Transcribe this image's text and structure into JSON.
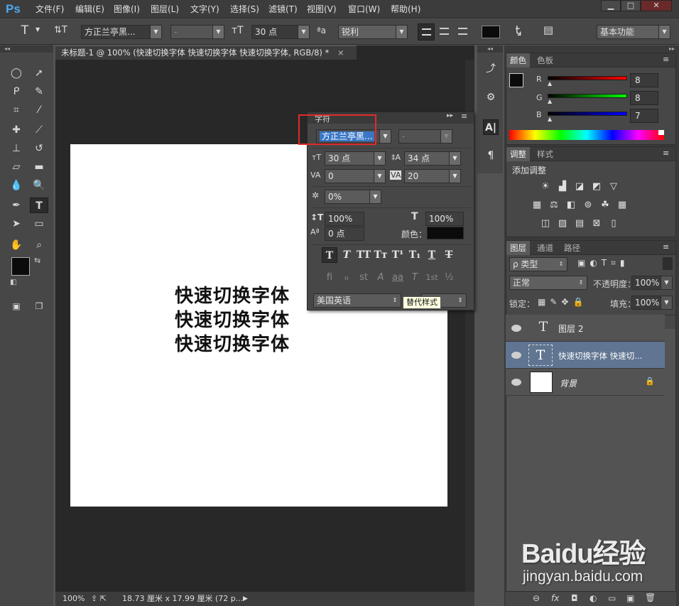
{
  "app": {
    "logo": "Ps"
  },
  "menu": [
    "文件(F)",
    "编辑(E)",
    "图像(I)",
    "图层(L)",
    "文字(Y)",
    "选择(S)",
    "滤镜(T)",
    "视图(V)",
    "窗口(W)",
    "帮助(H)"
  ],
  "window_buttons": {
    "minimize": "▁",
    "maximize": "□",
    "close": "✕"
  },
  "options": {
    "tool_glyph": "T",
    "orient_glyph": "⇅T",
    "font_family": "方正兰亭黑...",
    "font_style": "-",
    "size_glyph": "тT",
    "font_size": "30 点",
    "aa_glyph": "ªa",
    "antialias": "锐利",
    "workspace": "基本功能"
  },
  "document": {
    "tab_title": "未标题-1 @ 100% (快速切换字体 快速切换字体 快速切换字体, RGB/8) *",
    "tab_close": "×",
    "lines": [
      "快速切换字体",
      "快速切换字体",
      "快速切换字体"
    ],
    "status_zoom": "100%",
    "status_info": "18.73 厘米 x 17.99 厘米 (72 p..."
  },
  "character_panel": {
    "title": "字符",
    "font_family": "方正兰亭黑...",
    "font_style": "-",
    "font_size": "30 点",
    "leading": "34 点",
    "kerning": "0",
    "tracking": "20",
    "tsume": "0%",
    "vertical_scale": "100%",
    "horizontal_scale": "100%",
    "baseline_shift": "0 点",
    "color_label": "颜色：",
    "language": "美国英语",
    "tooltip": "替代样式",
    "style_buttons": [
      "T",
      "T",
      "TT",
      "Tт",
      "T¹",
      "T₁",
      "T",
      "T"
    ],
    "opentype_buttons": [
      "ﬁ",
      "ℴ",
      "st",
      "A",
      "aa",
      "T",
      "1st",
      "½"
    ],
    "highlight_color": "#e12a2a"
  },
  "color_panel": {
    "tabs": [
      "颜色",
      "色板"
    ],
    "r_label": "R",
    "g_label": "G",
    "b_label": "B",
    "r": "8",
    "g": "8",
    "b": "7"
  },
  "adjustments_panel": {
    "tabs": [
      "调整",
      "样式"
    ],
    "heading": "添加调整"
  },
  "layers_panel": {
    "tabs": [
      "图层",
      "通道",
      "路径"
    ],
    "filter": "ρ 类型",
    "blend_mode": "正常",
    "opacity_label": "不透明度：",
    "opacity": "100%",
    "lock_label": "锁定：",
    "fill_label": "填充：",
    "fill": "100%",
    "layers": [
      {
        "name": "图层 2",
        "type": "text"
      },
      {
        "name": "快速切换字体 快速切...",
        "type": "text"
      },
      {
        "name": "背景",
        "type": "background"
      }
    ],
    "footer_icons": [
      "⊖",
      "fx",
      "◘",
      "◐",
      "▭",
      "▣",
      "🗑"
    ]
  },
  "watermark": {
    "brand": "Baidu经验",
    "url": "jingyan.baidu.com"
  },
  "colors": {
    "ui_dark": "#474747",
    "canvas": "#ffffff",
    "selection_blue": "#5f7591",
    "highlight_red": "#e12a2a"
  }
}
